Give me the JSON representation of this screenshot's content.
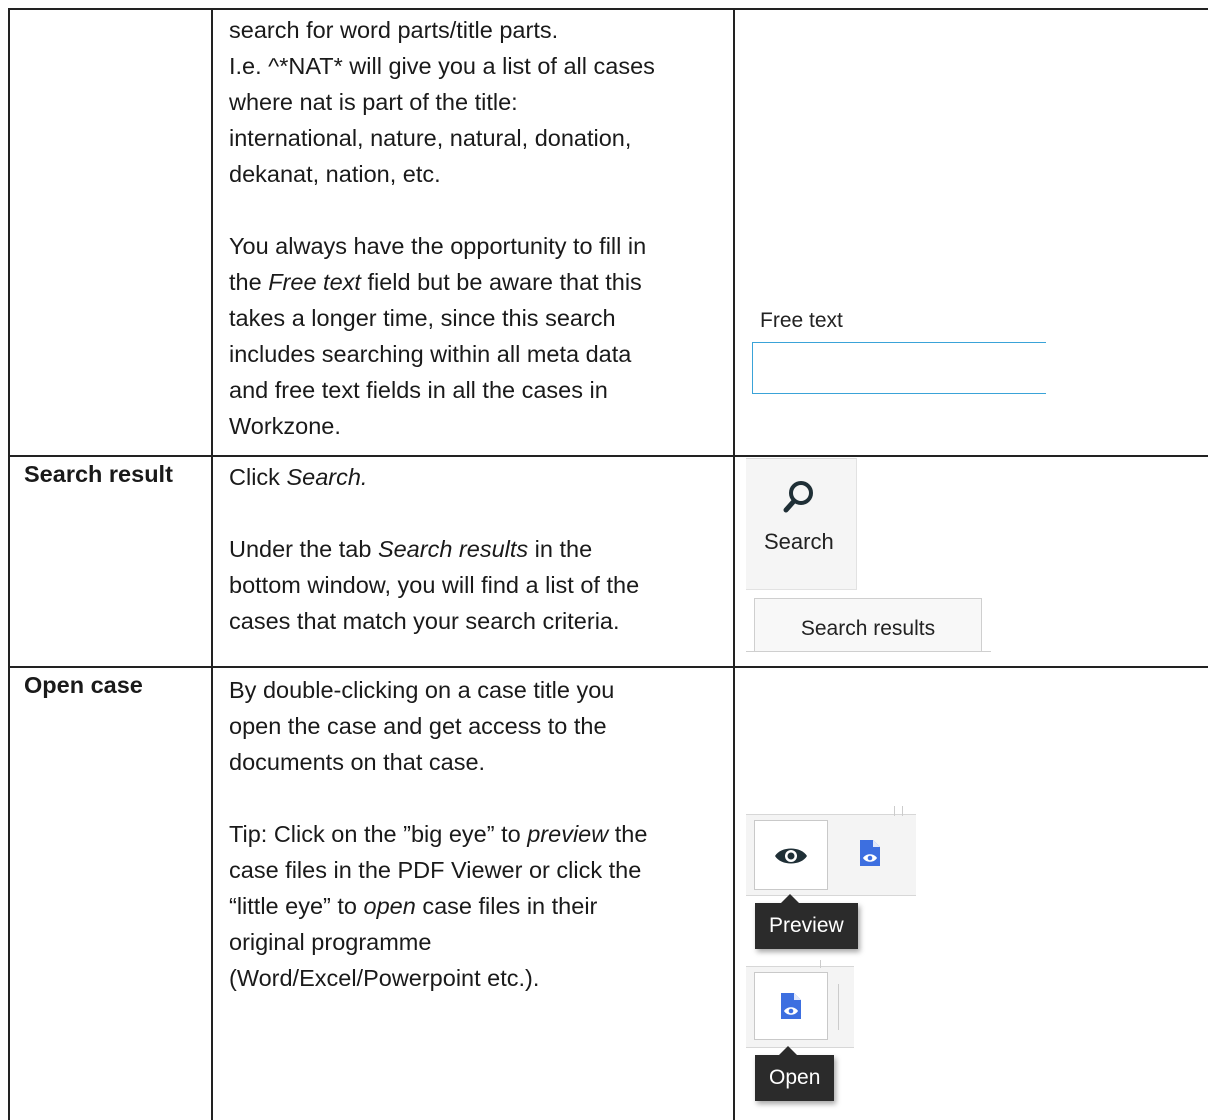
{
  "row1": {
    "lines": [
      "search for word parts/title parts.",
      "I.e. ^*NAT* will give you a list of all cases",
      "where nat is part of the title:",
      "international, nature, natural, donation,",
      "dekanat, nation, etc."
    ],
    "free_text_para": {
      "line1": "You always have the opportunity to fill in",
      "line2_pre": "the ",
      "line2_italic": "Free text",
      "line2_post": " field but be aware that this",
      "line3": "takes a longer time, since this search",
      "line4": "includes searching within all meta data",
      "line5": "and free text fields in all the cases in",
      "line6": "Workzone."
    },
    "free_text_label": "Free text"
  },
  "row2": {
    "label": "Search result",
    "click_pre": "Click ",
    "click_italic": "Search.",
    "para": {
      "line1_pre": "Under the tab ",
      "line1_italic": "Search results",
      "line1_post": " in the",
      "line2": "bottom window, you will find a list of the",
      "line3": "cases that match your search criteria."
    },
    "search_button_label": "Search",
    "search_results_tab": "Search results"
  },
  "row3": {
    "label": "Open case",
    "lines": [
      "By double-clicking on a case title you",
      "open the case and get access to the",
      "documents on that case."
    ],
    "tip": {
      "line1_pre": "Tip: Click on the ”big eye” to ",
      "line1_italic": "preview",
      "line1_post": " the",
      "line2": "case files in the PDF Viewer or click the",
      "line3_pre": "“little eye” to ",
      "line3_italic": "open",
      "line3_post": " case files in their",
      "line4": "original programme",
      "line5": "(Word/Excel/Powerpoint etc.)."
    },
    "preview_tooltip": "Preview",
    "open_tooltip": "Open"
  },
  "colors": {
    "input_border": "#3aa3d8",
    "doc_icon": "#3d6fe0",
    "eye_icon": "#1f2f36",
    "tooltip_bg": "#2b2b2b"
  }
}
